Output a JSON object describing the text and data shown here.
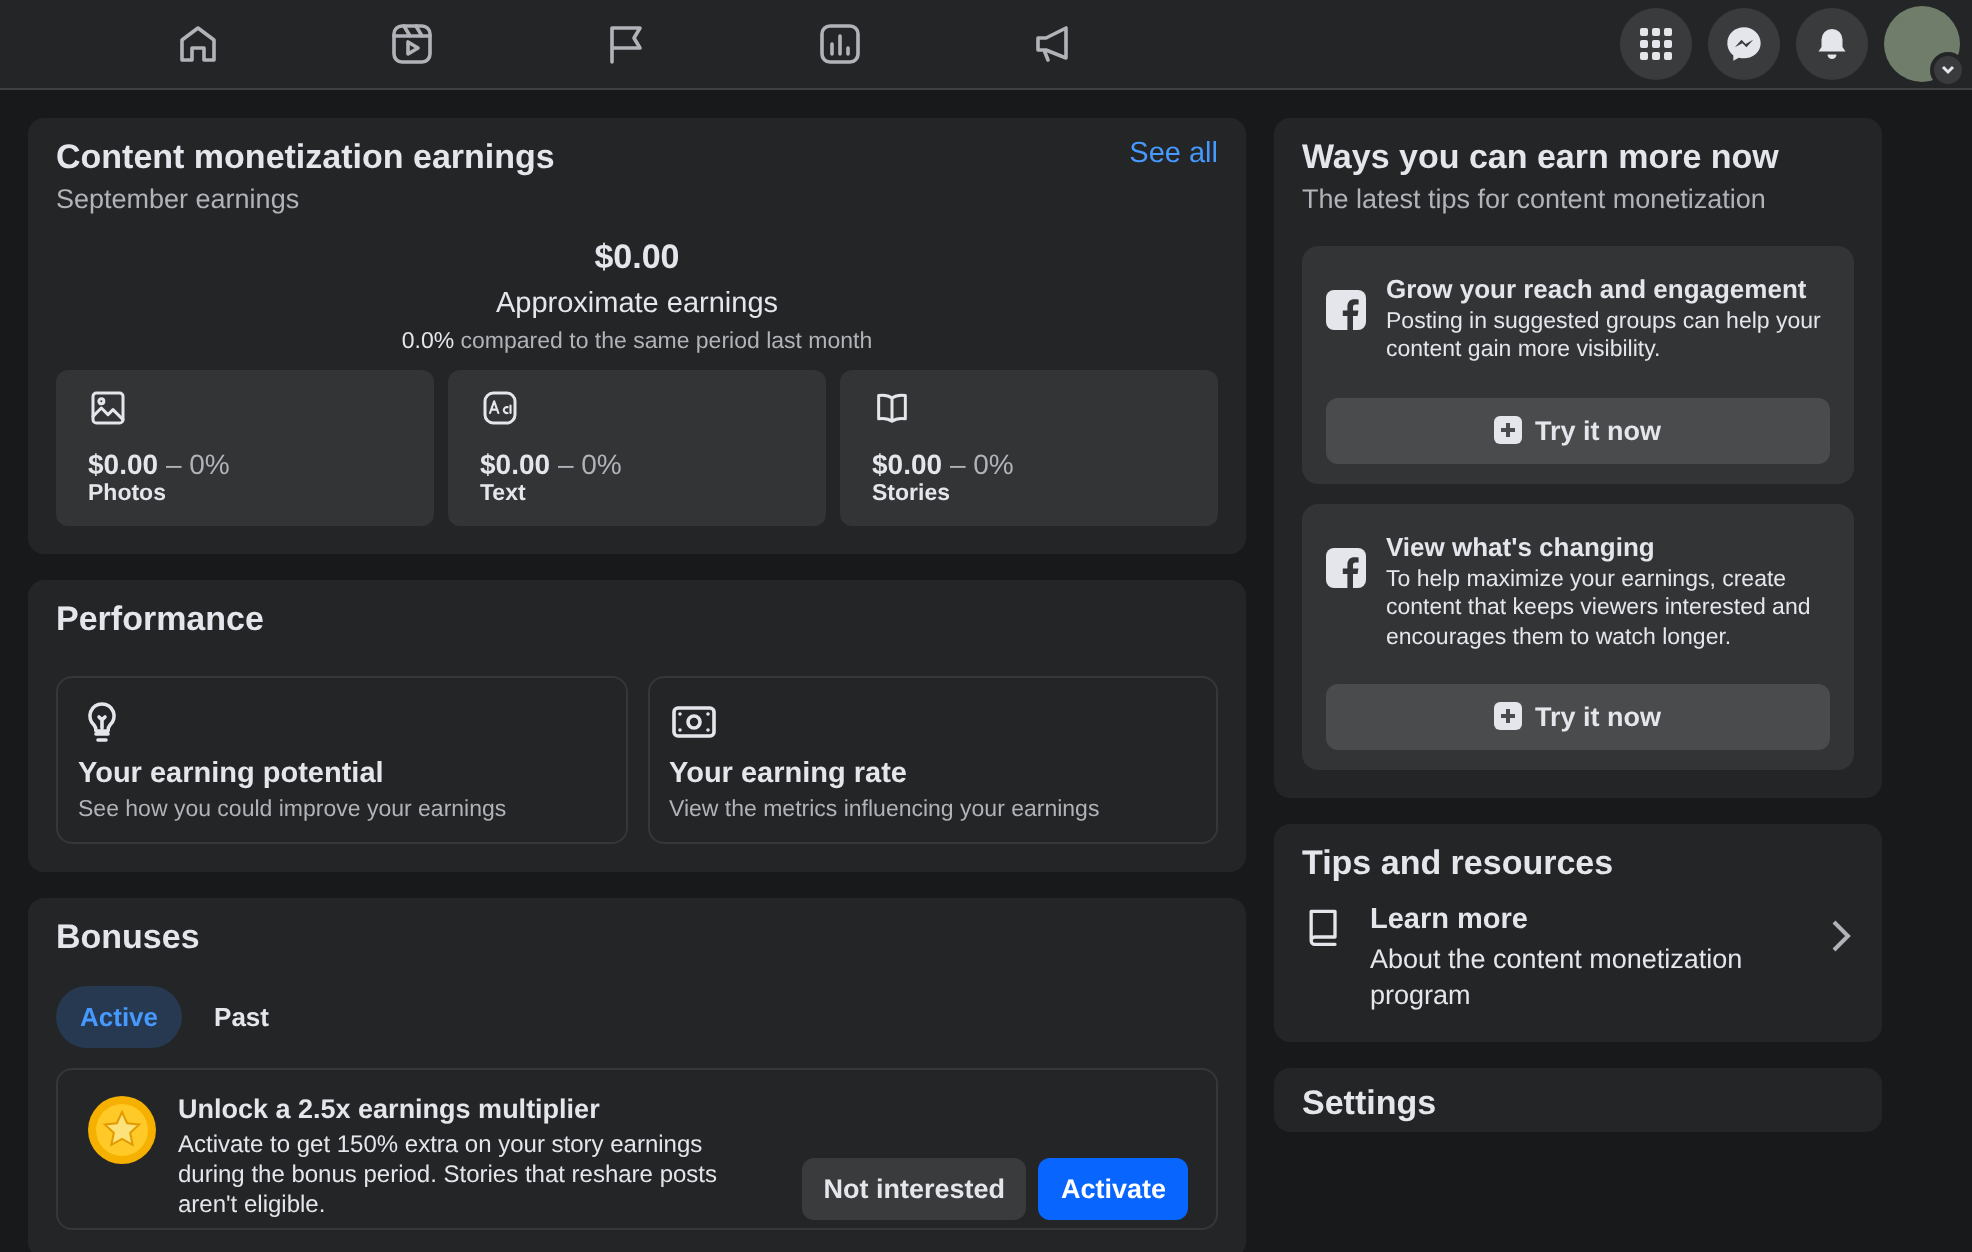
{
  "earnings": {
    "title": "Content monetization earnings",
    "subtitle": "September earnings",
    "link": "See all",
    "total": "$0.00",
    "total_label": "Approximate earnings",
    "comparison": "**0.0%** compared to the same period last month",
    "breakdown": [
      {
        "kind": "photos",
        "amount": "$0.00",
        "change": "– 0%",
        "label": "Photos"
      },
      {
        "kind": "text",
        "amount": "$0.00",
        "change": "– 0%",
        "label": "Text"
      },
      {
        "kind": "stories",
        "amount": "$0.00",
        "change": "– 0%",
        "label": "Stories"
      }
    ]
  },
  "performance": {
    "title": "Performance",
    "items": [
      {
        "kind": "potential",
        "title": "Your earning potential",
        "description": "See how you could improve your earnings"
      },
      {
        "kind": "rate",
        "title": "Your earning rate",
        "description": "View the metrics influencing your earnings"
      }
    ]
  },
  "bonuses": {
    "title": "Bonuses",
    "tabs": [
      {
        "label": "Active",
        "selected": true
      },
      {
        "label": "Past",
        "selected": false
      }
    ],
    "offers": [
      {
        "title": "Unlock a 2.5x earnings multiplier",
        "description": "Activate to get 150% extra on your story earnings during the bonus period. Stories that reshare posts aren't eligible.",
        "buttons": [
          {
            "label": "Not interested",
            "kind": "secondary"
          },
          {
            "label": "Activate",
            "kind": "primary"
          }
        ]
      }
    ]
  },
  "tips": {
    "title": "Ways you can earn more now",
    "subtitle": "The latest tips for content monetization",
    "items": [
      {
        "title": "Grow your reach and engagement",
        "description": "Posting in suggested groups can help your content gain more visibility.",
        "button": "Try it now"
      },
      {
        "title": "View what's changing",
        "description": "To help maximize your earnings, create content that keeps viewers interested and encourages them to watch longer.",
        "button": "Try it now"
      }
    ]
  },
  "resources": {
    "title": "Tips and resources",
    "items": [
      {
        "title": "Learn more",
        "description": "About the content monetization program"
      }
    ]
  },
  "settings": {
    "title": "Settings"
  }
}
